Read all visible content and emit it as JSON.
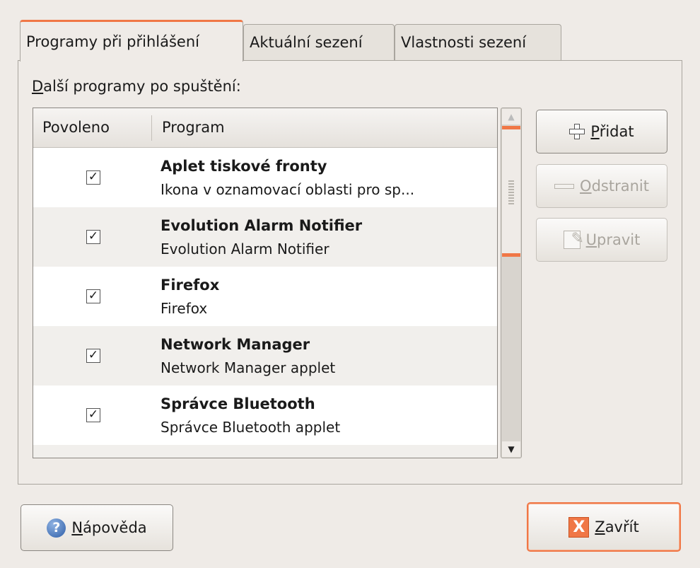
{
  "tabs": [
    {
      "label": "Programy při přihlášení",
      "active": true
    },
    {
      "label": "Aktuální sezení",
      "active": false
    },
    {
      "label": "Vlastnosti sezení",
      "active": false
    }
  ],
  "section_label": {
    "accel": "D",
    "rest": "alší programy po spuštění:"
  },
  "list": {
    "columns": [
      "Povoleno",
      "Program"
    ],
    "rows": [
      {
        "enabled": true,
        "name": "Aplet tiskové fronty",
        "description": "Ikona v oznamovací oblasti pro sp..."
      },
      {
        "enabled": true,
        "name": "Evolution Alarm Notifier",
        "description": "Evolution Alarm Notifier"
      },
      {
        "enabled": true,
        "name": "Firefox",
        "description": "Firefox"
      },
      {
        "enabled": true,
        "name": "Network Manager",
        "description": "Network Manager applet"
      },
      {
        "enabled": true,
        "name": "Správce Bluetooth",
        "description": "Správce Bluetooth applet"
      }
    ],
    "check_glyph": "✓"
  },
  "buttons": {
    "add": {
      "accel": "P",
      "rest": "řidat",
      "icon": "plus-icon",
      "enabled": true
    },
    "remove": {
      "accel": "O",
      "rest": "dstranit",
      "icon": "minus-icon",
      "enabled": false
    },
    "edit": {
      "accel": "U",
      "rest": "pravit",
      "icon": "edit-icon",
      "enabled": false
    },
    "help": {
      "accel": "N",
      "rest": "ápověda",
      "icon": "help-icon",
      "glyph": "?"
    },
    "close": {
      "accel": "Z",
      "rest": "avřít",
      "icon": "close-icon",
      "glyph": "X"
    }
  },
  "colors": {
    "accent": "#f07746",
    "background": "#efebe7",
    "help_blue": "#2f5fa8"
  }
}
